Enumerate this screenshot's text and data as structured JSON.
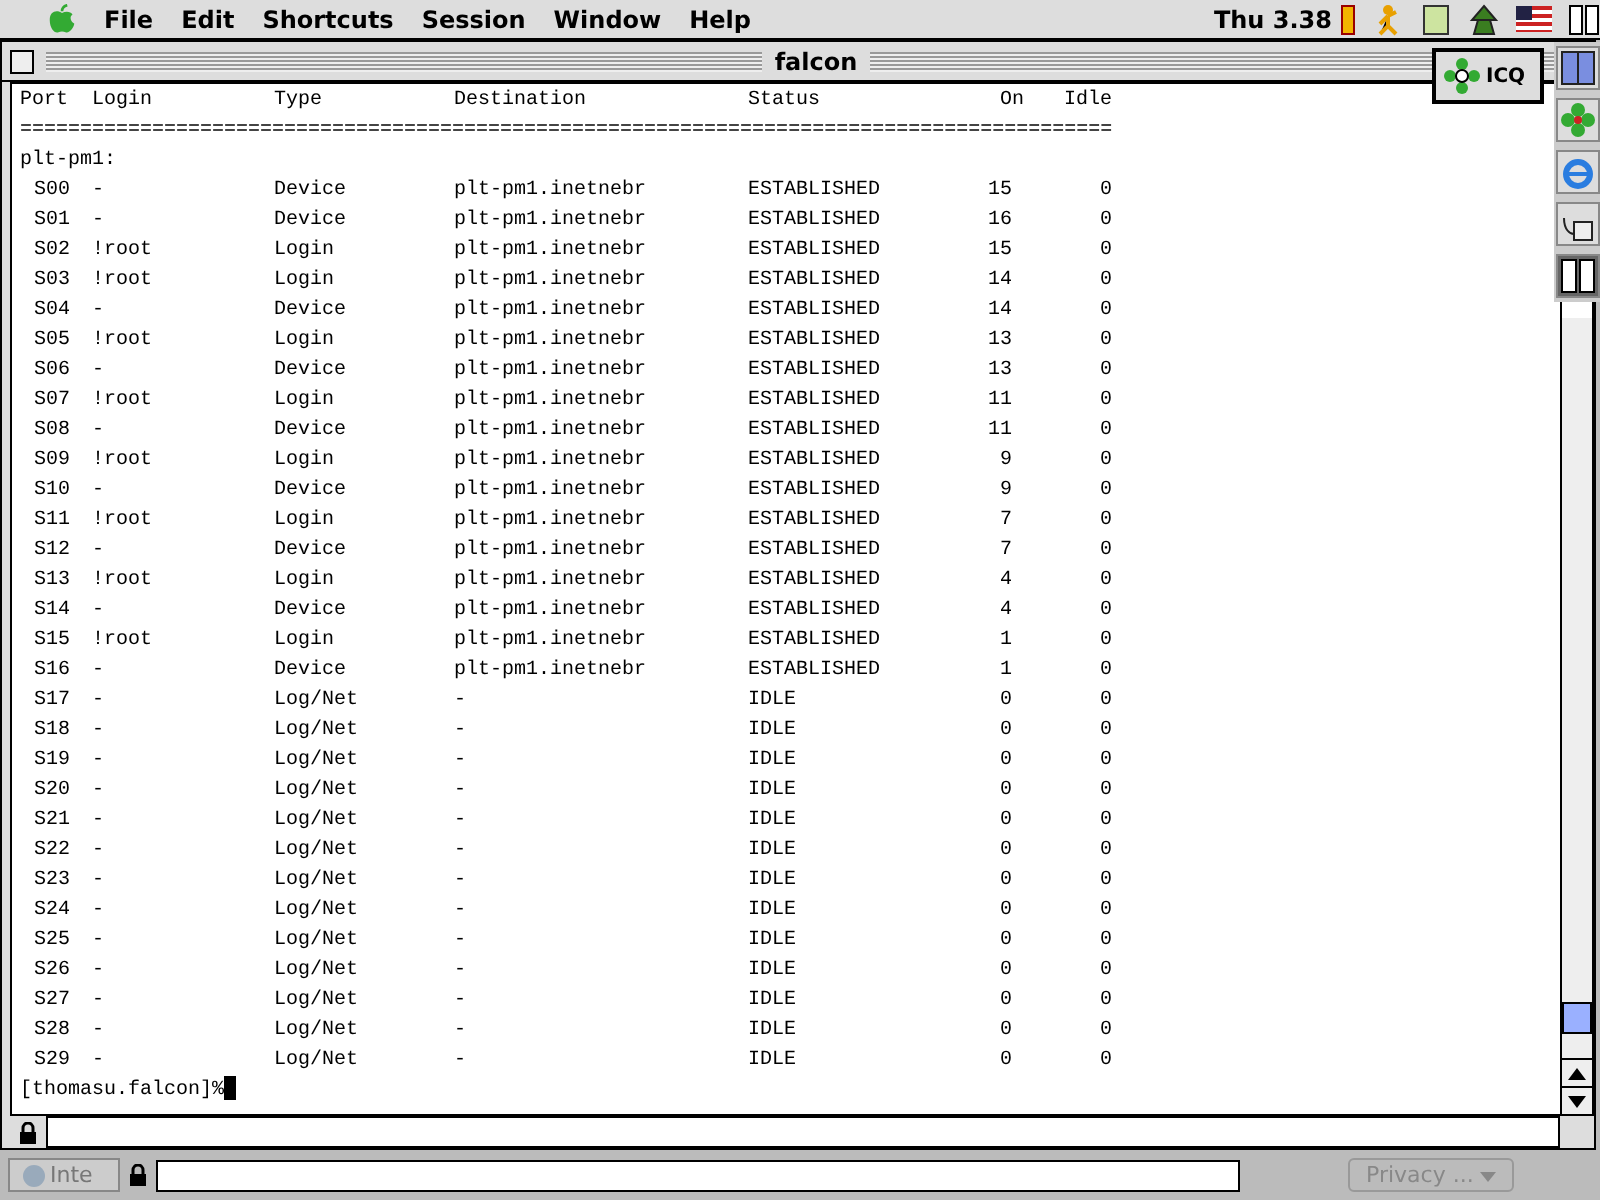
{
  "menu_bar": {
    "items": [
      "File",
      "Edit",
      "Shortcuts",
      "Session",
      "Window",
      "Help"
    ],
    "clock": "Thu 3.38"
  },
  "window": {
    "title": "falcon"
  },
  "floating_button": {
    "label": "ICQ"
  },
  "terminal": {
    "columns": [
      "Port",
      "Login",
      "Type",
      "Destination",
      "Status",
      "On",
      "Idle"
    ],
    "separator": "===========================================================================================",
    "group": "plt-pm1:",
    "rows": [
      {
        "port": "S00",
        "login": "-",
        "type": "Device",
        "destination": "plt-pm1.inetnebr",
        "status": "ESTABLISHED",
        "on": "15",
        "idle": "0"
      },
      {
        "port": "S01",
        "login": "-",
        "type": "Device",
        "destination": "plt-pm1.inetnebr",
        "status": "ESTABLISHED",
        "on": "16",
        "idle": "0"
      },
      {
        "port": "S02",
        "login": "!root",
        "type": "Login",
        "destination": "plt-pm1.inetnebr",
        "status": "ESTABLISHED",
        "on": "15",
        "idle": "0"
      },
      {
        "port": "S03",
        "login": "!root",
        "type": "Login",
        "destination": "plt-pm1.inetnebr",
        "status": "ESTABLISHED",
        "on": "14",
        "idle": "0"
      },
      {
        "port": "S04",
        "login": "-",
        "type": "Device",
        "destination": "plt-pm1.inetnebr",
        "status": "ESTABLISHED",
        "on": "14",
        "idle": "0"
      },
      {
        "port": "S05",
        "login": "!root",
        "type": "Login",
        "destination": "plt-pm1.inetnebr",
        "status": "ESTABLISHED",
        "on": "13",
        "idle": "0"
      },
      {
        "port": "S06",
        "login": "-",
        "type": "Device",
        "destination": "plt-pm1.inetnebr",
        "status": "ESTABLISHED",
        "on": "13",
        "idle": "0"
      },
      {
        "port": "S07",
        "login": "!root",
        "type": "Login",
        "destination": "plt-pm1.inetnebr",
        "status": "ESTABLISHED",
        "on": "11",
        "idle": "0"
      },
      {
        "port": "S08",
        "login": "-",
        "type": "Device",
        "destination": "plt-pm1.inetnebr",
        "status": "ESTABLISHED",
        "on": "11",
        "idle": "0"
      },
      {
        "port": "S09",
        "login": "!root",
        "type": "Login",
        "destination": "plt-pm1.inetnebr",
        "status": "ESTABLISHED",
        "on": "9",
        "idle": "0"
      },
      {
        "port": "S10",
        "login": "-",
        "type": "Device",
        "destination": "plt-pm1.inetnebr",
        "status": "ESTABLISHED",
        "on": "9",
        "idle": "0"
      },
      {
        "port": "S11",
        "login": "!root",
        "type": "Login",
        "destination": "plt-pm1.inetnebr",
        "status": "ESTABLISHED",
        "on": "7",
        "idle": "0"
      },
      {
        "port": "S12",
        "login": "-",
        "type": "Device",
        "destination": "plt-pm1.inetnebr",
        "status": "ESTABLISHED",
        "on": "7",
        "idle": "0"
      },
      {
        "port": "S13",
        "login": "!root",
        "type": "Login",
        "destination": "plt-pm1.inetnebr",
        "status": "ESTABLISHED",
        "on": "4",
        "idle": "0"
      },
      {
        "port": "S14",
        "login": "-",
        "type": "Device",
        "destination": "plt-pm1.inetnebr",
        "status": "ESTABLISHED",
        "on": "4",
        "idle": "0"
      },
      {
        "port": "S15",
        "login": "!root",
        "type": "Login",
        "destination": "plt-pm1.inetnebr",
        "status": "ESTABLISHED",
        "on": "1",
        "idle": "0"
      },
      {
        "port": "S16",
        "login": "-",
        "type": "Device",
        "destination": "plt-pm1.inetnebr",
        "status": "ESTABLISHED",
        "on": "1",
        "idle": "0"
      },
      {
        "port": "S17",
        "login": "-",
        "type": "Log/Net",
        "destination": "-",
        "status": "IDLE",
        "on": "0",
        "idle": "0"
      },
      {
        "port": "S18",
        "login": "-",
        "type": "Log/Net",
        "destination": "-",
        "status": "IDLE",
        "on": "0",
        "idle": "0"
      },
      {
        "port": "S19",
        "login": "-",
        "type": "Log/Net",
        "destination": "-",
        "status": "IDLE",
        "on": "0",
        "idle": "0"
      },
      {
        "port": "S20",
        "login": "-",
        "type": "Log/Net",
        "destination": "-",
        "status": "IDLE",
        "on": "0",
        "idle": "0"
      },
      {
        "port": "S21",
        "login": "-",
        "type": "Log/Net",
        "destination": "-",
        "status": "IDLE",
        "on": "0",
        "idle": "0"
      },
      {
        "port": "S22",
        "login": "-",
        "type": "Log/Net",
        "destination": "-",
        "status": "IDLE",
        "on": "0",
        "idle": "0"
      },
      {
        "port": "S23",
        "login": "-",
        "type": "Log/Net",
        "destination": "-",
        "status": "IDLE",
        "on": "0",
        "idle": "0"
      },
      {
        "port": "S24",
        "login": "-",
        "type": "Log/Net",
        "destination": "-",
        "status": "IDLE",
        "on": "0",
        "idle": "0"
      },
      {
        "port": "S25",
        "login": "-",
        "type": "Log/Net",
        "destination": "-",
        "status": "IDLE",
        "on": "0",
        "idle": "0"
      },
      {
        "port": "S26",
        "login": "-",
        "type": "Log/Net",
        "destination": "-",
        "status": "IDLE",
        "on": "0",
        "idle": "0"
      },
      {
        "port": "S27",
        "login": "-",
        "type": "Log/Net",
        "destination": "-",
        "status": "IDLE",
        "on": "0",
        "idle": "0"
      },
      {
        "port": "S28",
        "login": "-",
        "type": "Log/Net",
        "destination": "-",
        "status": "IDLE",
        "on": "0",
        "idle": "0"
      },
      {
        "port": "S29",
        "login": "-",
        "type": "Log/Net",
        "destination": "-",
        "status": "IDLE",
        "on": "0",
        "idle": "0"
      }
    ],
    "prompt": "[thomasu.falcon]%"
  },
  "background_window": {
    "tab": "Inte",
    "dropdown": "Privacy ..."
  }
}
